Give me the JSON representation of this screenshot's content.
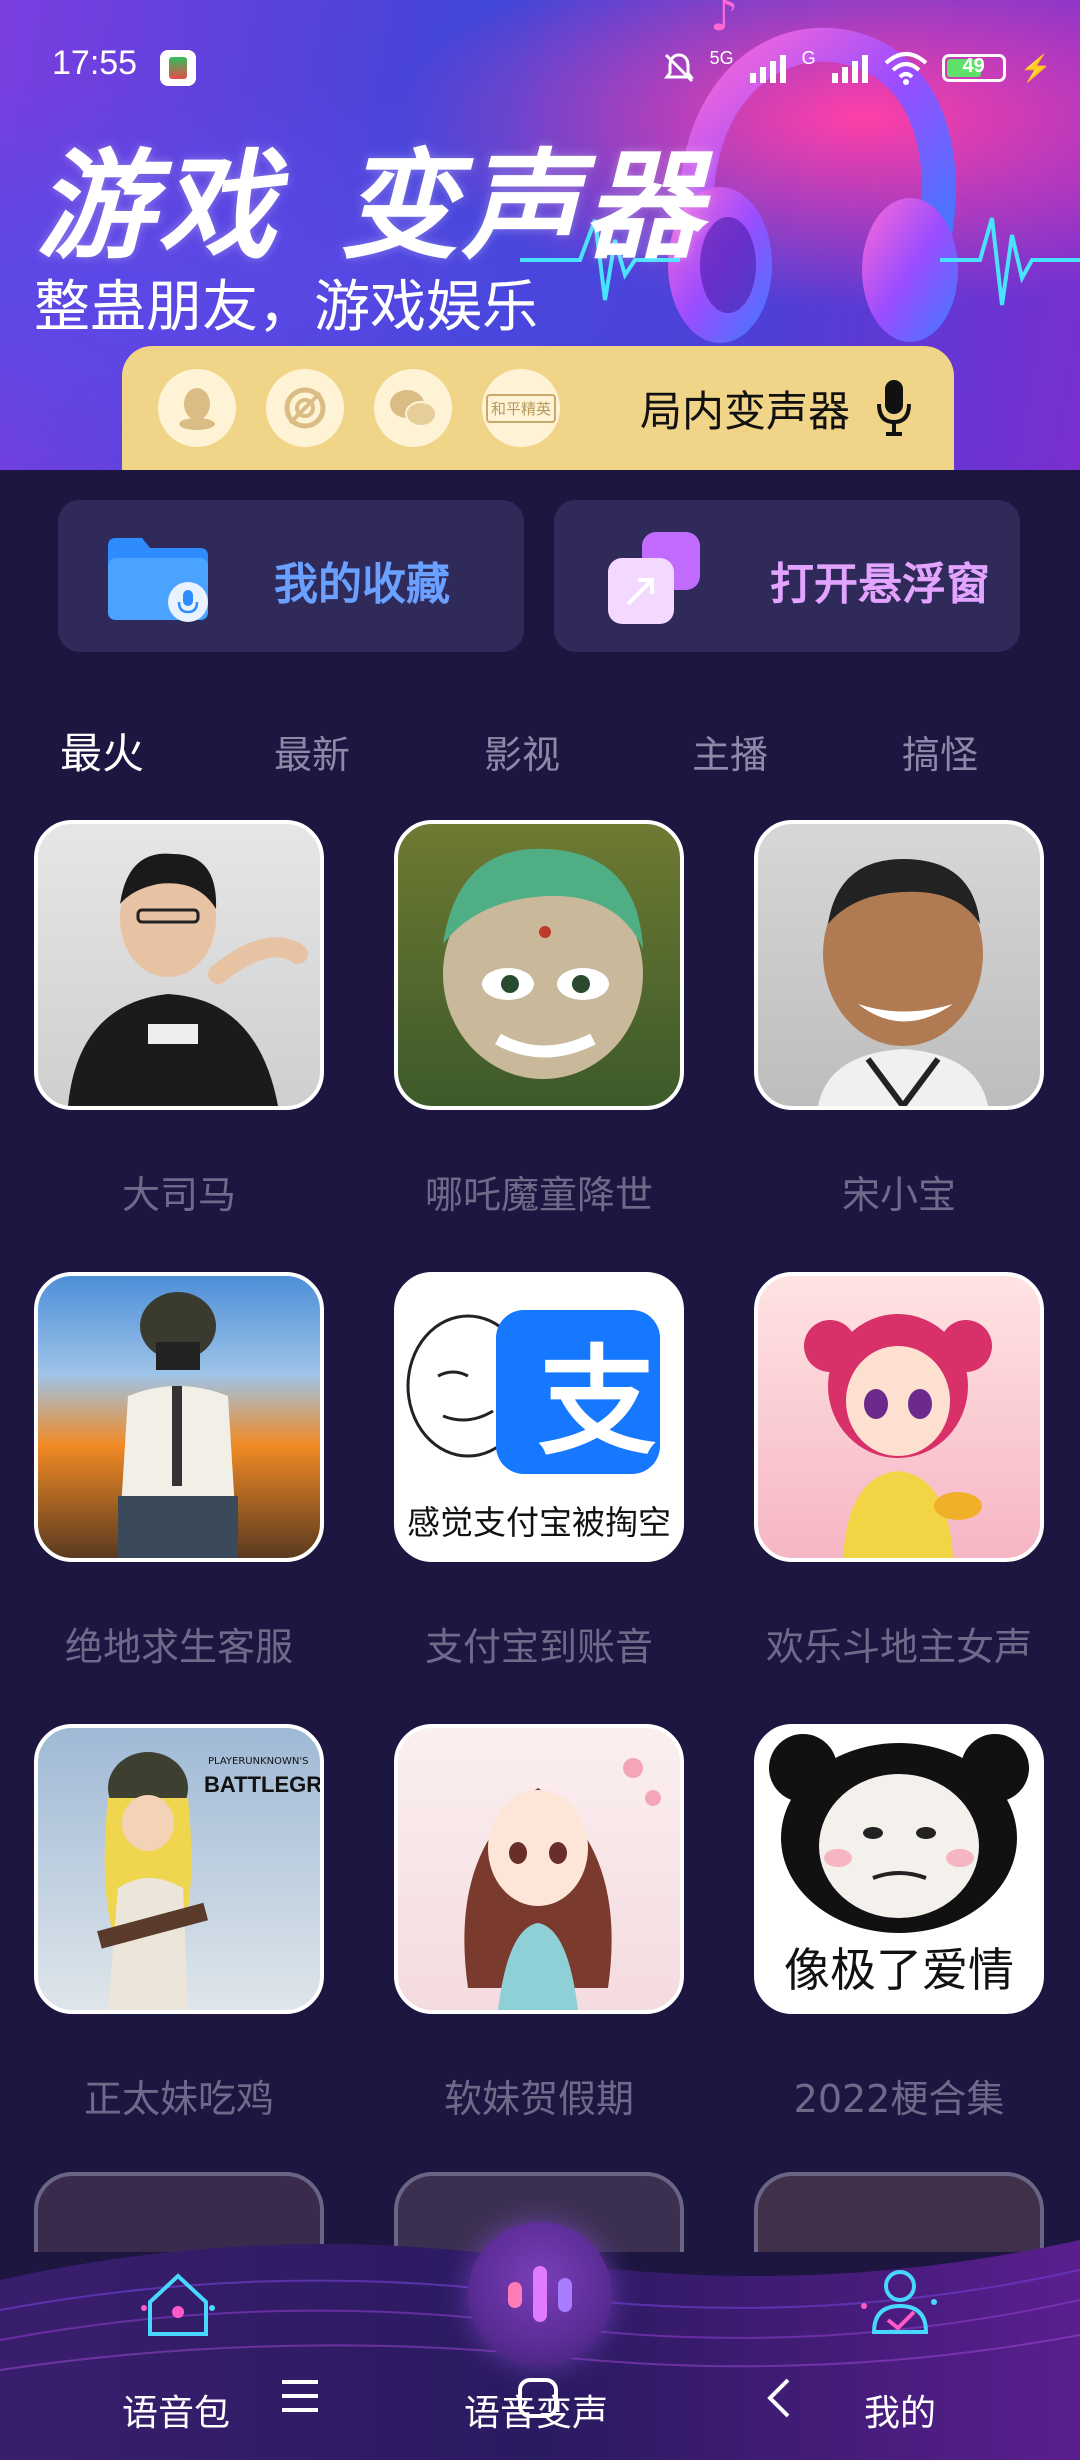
{
  "status_bar": {
    "time": "17:55",
    "network": "5G",
    "network2": "G",
    "battery": "49"
  },
  "banner": {
    "title_part1": "游戏",
    "title_part2": "变声器",
    "subtitle": "整蛊朋友，游戏娱乐",
    "share_targets": [
      "qq-icon",
      "game-icon",
      "wechat-icon",
      "peace-elite-icon"
    ],
    "share_small_text": "和平精英",
    "brand_label": "局内变声器"
  },
  "cards": {
    "favorites_label": "我的收藏",
    "float_window_label": "打开悬浮窗"
  },
  "tabs": [
    "最火",
    "最新",
    "影视",
    "主播",
    "搞怪"
  ],
  "grid": {
    "items": [
      {
        "label": "大司马"
      },
      {
        "label": "哪吒魔童降世"
      },
      {
        "label": "宋小宝"
      },
      {
        "label": "绝地求生客服"
      },
      {
        "label": "支付宝到账音",
        "image_text": "感觉支付宝被掏空",
        "logo_char": "支"
      },
      {
        "label": "欢乐斗地主女声"
      },
      {
        "label": "正太妹吃鸡",
        "image_text": "BATTLEGROUNDS",
        "image_small": "PLAYERUNKNOWN'S"
      },
      {
        "label": "软妹贺假期"
      },
      {
        "label": "2022梗合集",
        "image_text": "像极了爱情"
      }
    ]
  },
  "nav": {
    "voice_pack": "语音包",
    "voice_change": "语音变声",
    "mine": "我的"
  },
  "colors": {
    "background": "#1d1640",
    "card": "#302a5a",
    "favorites_text": "#6aa0ff",
    "float_text": "#e3a4ff",
    "brand_bar": "#f0d487"
  }
}
